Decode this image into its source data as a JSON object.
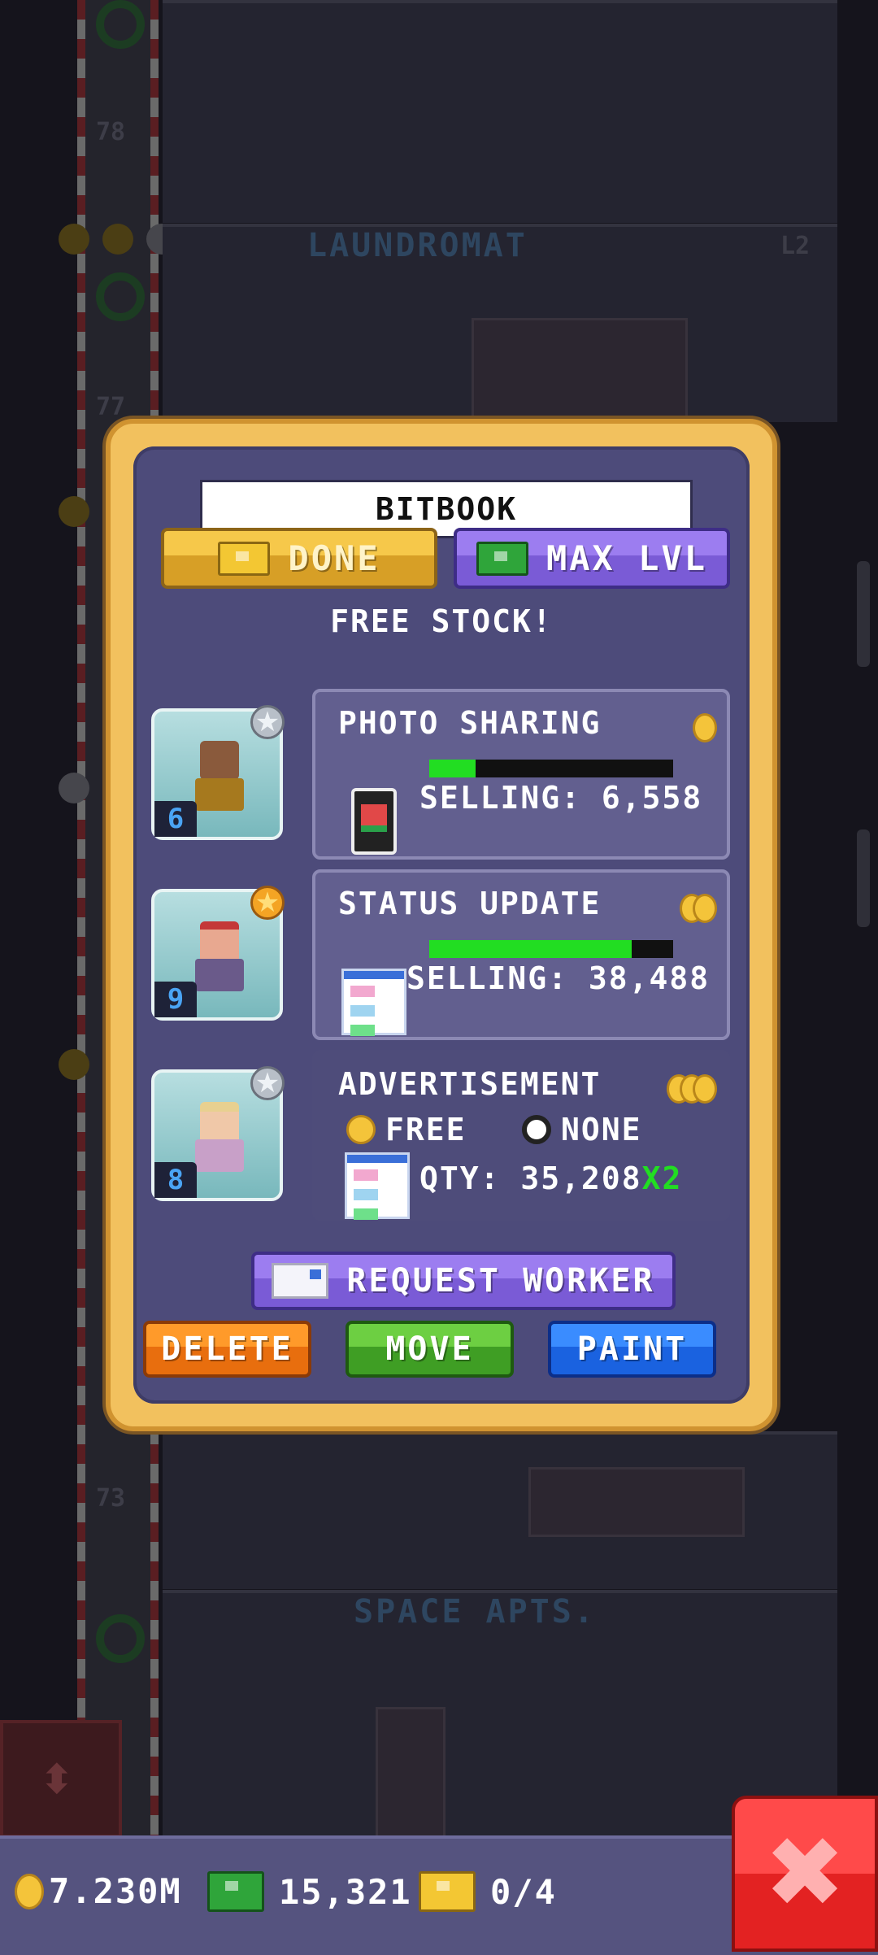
{
  "background": {
    "floor_labels": [
      "LAUNDROMAT",
      "SPACE APTS."
    ],
    "floor_numbers": [
      "78",
      "77",
      "73"
    ],
    "floor_level": "L2"
  },
  "dialog": {
    "title": "BITBOOK",
    "done_button": {
      "label": "DONE",
      "icon": "gold-bux-icon"
    },
    "max_button": {
      "label": "MAX LVL",
      "icon": "green-bux-icon"
    },
    "free_stock": "FREE STOCK!",
    "products": [
      {
        "name": "PHOTO SHARING",
        "selling": "SELLING: 6,558",
        "progress": 0.19,
        "coins": 1,
        "icon": "phone-icon",
        "worker": {
          "level": "6",
          "star": "silver"
        }
      },
      {
        "name": "STATUS UPDATE",
        "selling": "SELLING: 38,488",
        "progress": 0.83,
        "coins": 2,
        "icon": "profile-page-icon",
        "worker": {
          "level": "9",
          "star": "gold"
        }
      },
      {
        "name": "ADVERTISEMENT",
        "coins": 3,
        "option_cost": "FREE",
        "option_time": "NONE",
        "qty": "QTY: 35,208",
        "multiplier": "X2",
        "icon": "ad-page-icon",
        "worker": {
          "level": "8",
          "star": "silver"
        }
      }
    ],
    "request_worker": "REQUEST WORKER",
    "delete": "DELETE",
    "move": "MOVE",
    "paint": "PAINT"
  },
  "status_bar": {
    "coins": "7.230M",
    "bux": "15,321",
    "tickets": "0/4"
  },
  "colors": {
    "frame": "#f2c15e",
    "panel": "#4d4b7a",
    "progress": "#22dd22",
    "delete": "#e86e0e",
    "move": "#3f9e24",
    "paint": "#1a62e0",
    "close": "#e32222"
  }
}
